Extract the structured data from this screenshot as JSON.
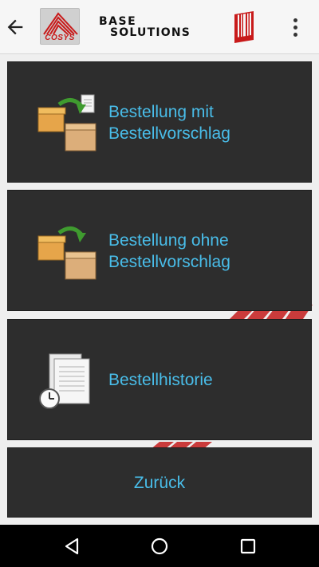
{
  "appbar": {
    "back_icon": "arrow-back-icon",
    "cosys_brand": "COSYS",
    "base_solutions_line1": "BASE",
    "base_solutions_line2": "SOLUTIONS",
    "barcode_icon": "barcode-icon",
    "menu_icon": "more-vert-icon"
  },
  "menu": {
    "items": [
      {
        "label_line1": "Bestellung mit",
        "label_line2": "Bestellvorschlag",
        "icon": "box-transfer-document-icon"
      },
      {
        "label_line1": "Bestellung ohne",
        "label_line2": "Bestellvorschlag",
        "icon": "box-transfer-icon"
      },
      {
        "label": "Bestellhistorie",
        "icon": "document-history-icon"
      }
    ],
    "back_label": "Zurück"
  },
  "navbar": {
    "back_icon": "nav-back-icon",
    "home_icon": "nav-home-icon",
    "recents_icon": "nav-recents-icon"
  },
  "colors": {
    "tile_background": "#2d2d2d",
    "label_color": "#49bde9",
    "accent_red": "#c81a1a"
  }
}
